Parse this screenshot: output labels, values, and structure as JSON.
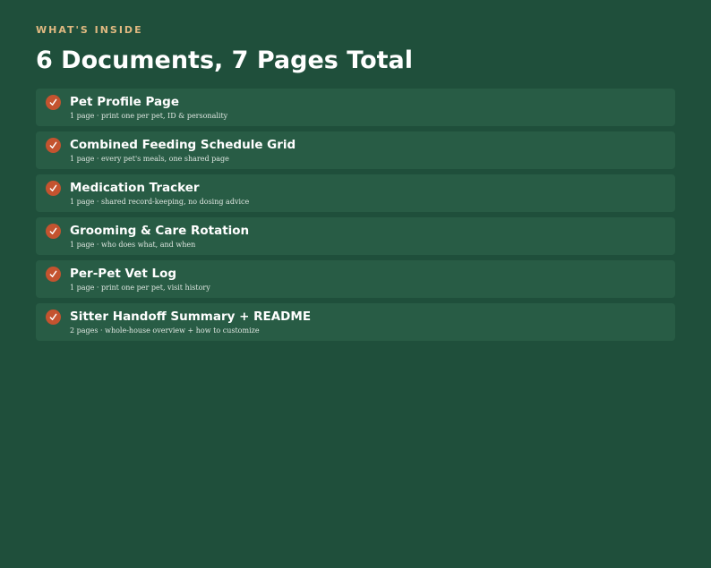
{
  "header": {
    "eyebrow": "WHAT'S INSIDE",
    "title": "6 Documents, 7 Pages Total"
  },
  "items": [
    {
      "title": "Pet Profile Page",
      "subtitle": "1 page · print one per pet, ID & personality"
    },
    {
      "title": "Combined Feeding Schedule Grid",
      "subtitle": "1 page · every pet's meals, one shared page"
    },
    {
      "title": "Medication Tracker",
      "subtitle": "1 page · shared record-keeping, no dosing advice"
    },
    {
      "title": "Grooming & Care Rotation",
      "subtitle": "1 page · who does what, and when"
    },
    {
      "title": "Per-Pet Vet Log",
      "subtitle": "1 page · print one per pet, visit history"
    },
    {
      "title": "Sitter Handoff Summary + README",
      "subtitle": "2 pages · whole-house overview + how to customize"
    }
  ],
  "icons": {
    "check": "check-icon"
  },
  "colors": {
    "background": "#1f4f3b",
    "card": "#285c45",
    "accent": "#c4532f",
    "eyebrow": "#e0b981"
  }
}
